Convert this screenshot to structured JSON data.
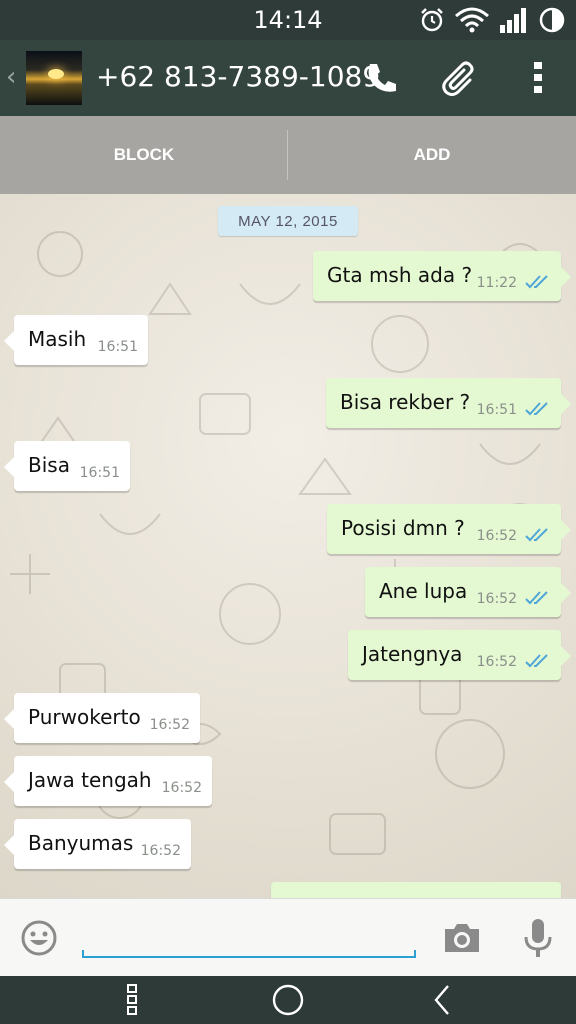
{
  "status_bar": {
    "time": "14:14"
  },
  "header": {
    "contact": "+62 813-7389-1089"
  },
  "block_bar": {
    "block_label": "BLOCK",
    "add_label": "ADD"
  },
  "date_label": "MAY 12, 2015",
  "messages": [
    {
      "direction": "out",
      "text": "Gta msh ada ?",
      "time": "11:22",
      "status": "read"
    },
    {
      "direction": "in",
      "text": "Masih",
      "time": "16:51"
    },
    {
      "direction": "out",
      "text": "Bisa rekber ?",
      "time": "16:51",
      "status": "read"
    },
    {
      "direction": "in",
      "text": "Bisa",
      "time": "16:51"
    },
    {
      "direction": "out",
      "text": "Posisi dmn ?",
      "time": "16:52",
      "status": "read"
    },
    {
      "direction": "out",
      "text": "Ane lupa",
      "time": "16:52",
      "status": "read"
    },
    {
      "direction": "out",
      "text": "Jatengnya",
      "time": "16:52",
      "status": "read"
    },
    {
      "direction": "in",
      "text": "Purwokerto",
      "time": "16:52"
    },
    {
      "direction": "in",
      "text": "Jawa tengah",
      "time": "16:52"
    },
    {
      "direction": "in",
      "text": "Banyumas",
      "time": "16:52"
    }
  ],
  "input": {
    "value": ""
  },
  "icons": {
    "back": "chevron-left-icon",
    "call": "phone-icon",
    "attach": "paperclip-icon",
    "menu": "overflow-menu-icon",
    "emoji": "emoji-icon",
    "camera": "camera-icon",
    "mic": "microphone-icon",
    "alarm": "alarm-icon",
    "wifi": "wifi-icon",
    "signal": "signal-icon",
    "battery": "battery-icon",
    "nav_menu": "menu-dots-icon",
    "nav_home": "home-icon",
    "nav_back": "back-icon"
  },
  "colors": {
    "tick_read": "#4fa6d8",
    "outgoing_bubble": "#e4f9d2",
    "incoming_bubble": "#ffffff",
    "input_accent": "#2c9fd3",
    "header": "#34443f"
  }
}
